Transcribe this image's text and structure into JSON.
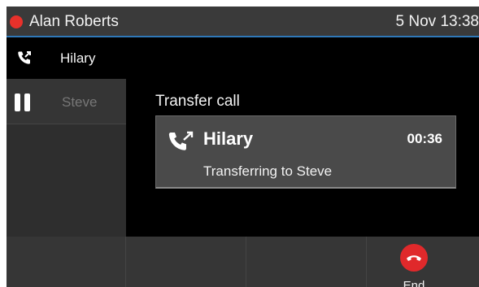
{
  "status_bar": {
    "name": "Alan Roberts",
    "datetime": "5 Nov 13:38",
    "indicator_color": "#e8312b"
  },
  "active_call": {
    "icon": "call-transfer-icon",
    "label": "Hilary"
  },
  "held_calls": [
    {
      "icon": "pause-icon",
      "label": "Steve"
    }
  ],
  "main": {
    "title": "Transfer call",
    "card": {
      "icon": "call-transfer-icon",
      "name": "Hilary",
      "timer": "00:36",
      "status": "Transferring to Steve"
    }
  },
  "softkeys": [
    {
      "label": ""
    },
    {
      "label": ""
    },
    {
      "label": ""
    },
    {
      "icon": "end-call-icon",
      "label": "End",
      "color": "#e0292b"
    }
  ]
}
